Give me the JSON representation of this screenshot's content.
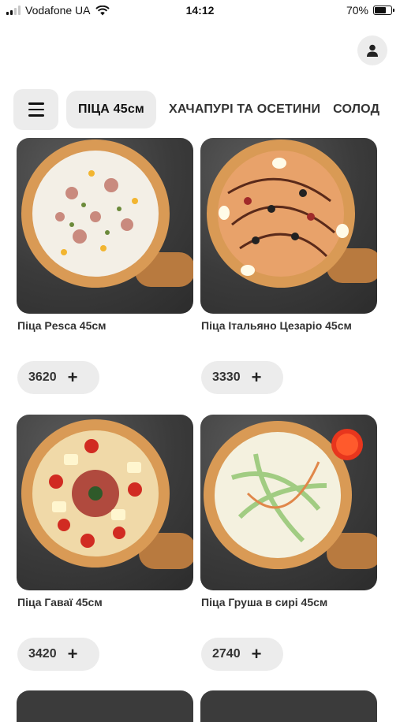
{
  "status_bar": {
    "carrier": "Vodafone UA",
    "time": "14:12",
    "battery": "70%",
    "battery_level": 0.7
  },
  "header": {
    "profile_icon": "user-icon"
  },
  "categories": {
    "menu_icon": "hamburger-icon",
    "items": [
      {
        "label": "ПІЦА 45см",
        "active": true
      },
      {
        "label": "ХАЧАПУРІ ТА ОСЕТИНИ",
        "active": false
      },
      {
        "label": "СОЛОД",
        "active": false
      }
    ]
  },
  "products": [
    {
      "name": "Піца Pesca 45см",
      "price": "3620",
      "add": "+"
    },
    {
      "name": "Піца Італьяно Цезаріо 45см",
      "price": "3330",
      "add": "+"
    },
    {
      "name": "Піца Гаваї 45см",
      "price": "3420",
      "add": "+"
    },
    {
      "name": "Піца Груша в сирі 45см",
      "price": "2740",
      "add": "+"
    }
  ],
  "colors": {
    "chip_bg": "#ececec",
    "text": "#333333",
    "board": "#b87a3f",
    "crust": "#d99a55"
  }
}
